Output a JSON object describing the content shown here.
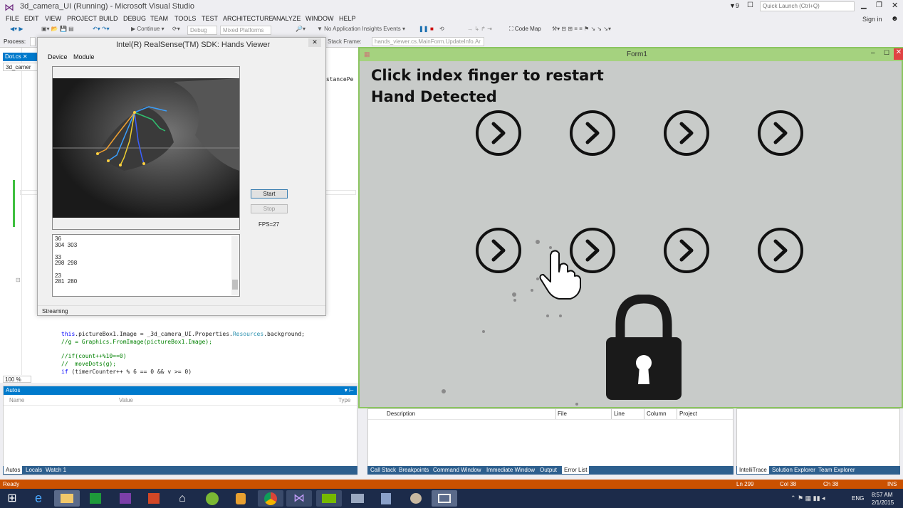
{
  "window": {
    "title": "3d_camera_UI (Running) - Microsoft Visual Studio",
    "notif_count": "9",
    "quick_launch_placeholder": "Quick Launch (Ctrl+Q)",
    "sign_in": "Sign in"
  },
  "menu": [
    "FILE",
    "EDIT",
    "VIEW",
    "PROJECT",
    "BUILD",
    "DEBUG",
    "TEAM",
    "TOOLS",
    "TEST",
    "ARCHITECTURE",
    "ANALYZE",
    "WINDOW",
    "HELP"
  ],
  "toolbar": {
    "continue": "Continue",
    "config": "Debug",
    "platform": "Mixed Platforms",
    "insights": "No Application Insights Events",
    "code_map": "Code Map"
  },
  "toolbar2": {
    "process_label": "Process:",
    "stack_frame_label": "Stack Frame:",
    "stack_frame_value": "hands_viewer.cs.MainForm.UpdateInfo.Ar"
  },
  "editor": {
    "doc_tab": "Dot.cs",
    "file_tab": "3d_camer",
    "right_snippet": "istancePe",
    "code_lines": [
      "this.pictureBox1.Image = _3d_camera_UI.Properties.Resources.background;",
      "//g = Graphics.FromImage(pictureBox1.Image);",
      "",
      "//if(count++%10==0)",
      "//  moveDots(g);",
      "if (timerCounter++ % 6 == 0 && v >= 0)"
    ],
    "zoom": "100 %"
  },
  "hands_viewer": {
    "title": "Intel(R) RealSense(TM) SDK: Hands Viewer",
    "menu": [
      "Device",
      "Module"
    ],
    "start": "Start",
    "stop": "Stop",
    "fps": "FPS=27",
    "log": "36\n304  303\n\n33\n298  298\n\n23\n281  280",
    "status": "Streaming"
  },
  "form1": {
    "title": "Form1",
    "line1": "Click index finger to restart",
    "line2": "Hand Detected",
    "button_count": 8
  },
  "autos": {
    "title": "Autos",
    "columns": [
      "Name",
      "Value",
      "Type"
    ],
    "tabs": [
      "Autos",
      "Locals",
      "Watch 1"
    ]
  },
  "error_list": {
    "columns": [
      "Description",
      "File",
      "Line",
      "Column",
      "Project"
    ],
    "tabs": [
      "Call Stack",
      "Breakpoints",
      "Command Window",
      "Immediate Window",
      "Output",
      "Error List"
    ]
  },
  "right_panel": {
    "tabs": [
      "IntelliTrace",
      "Solution Explorer",
      "Team Explorer"
    ]
  },
  "status_bar": {
    "ready": "Ready",
    "ln": "Ln 299",
    "col": "Col 38",
    "ch": "Ch 38",
    "ins": "INS"
  },
  "taskbar": {
    "lang": "ENG",
    "time": "8:57 AM",
    "date": "2/1/2015"
  },
  "colors": {
    "accent": "#007acc",
    "status_bar": "#ca5100",
    "form_border": "#8bc560",
    "form_title": "#a5d27f"
  }
}
